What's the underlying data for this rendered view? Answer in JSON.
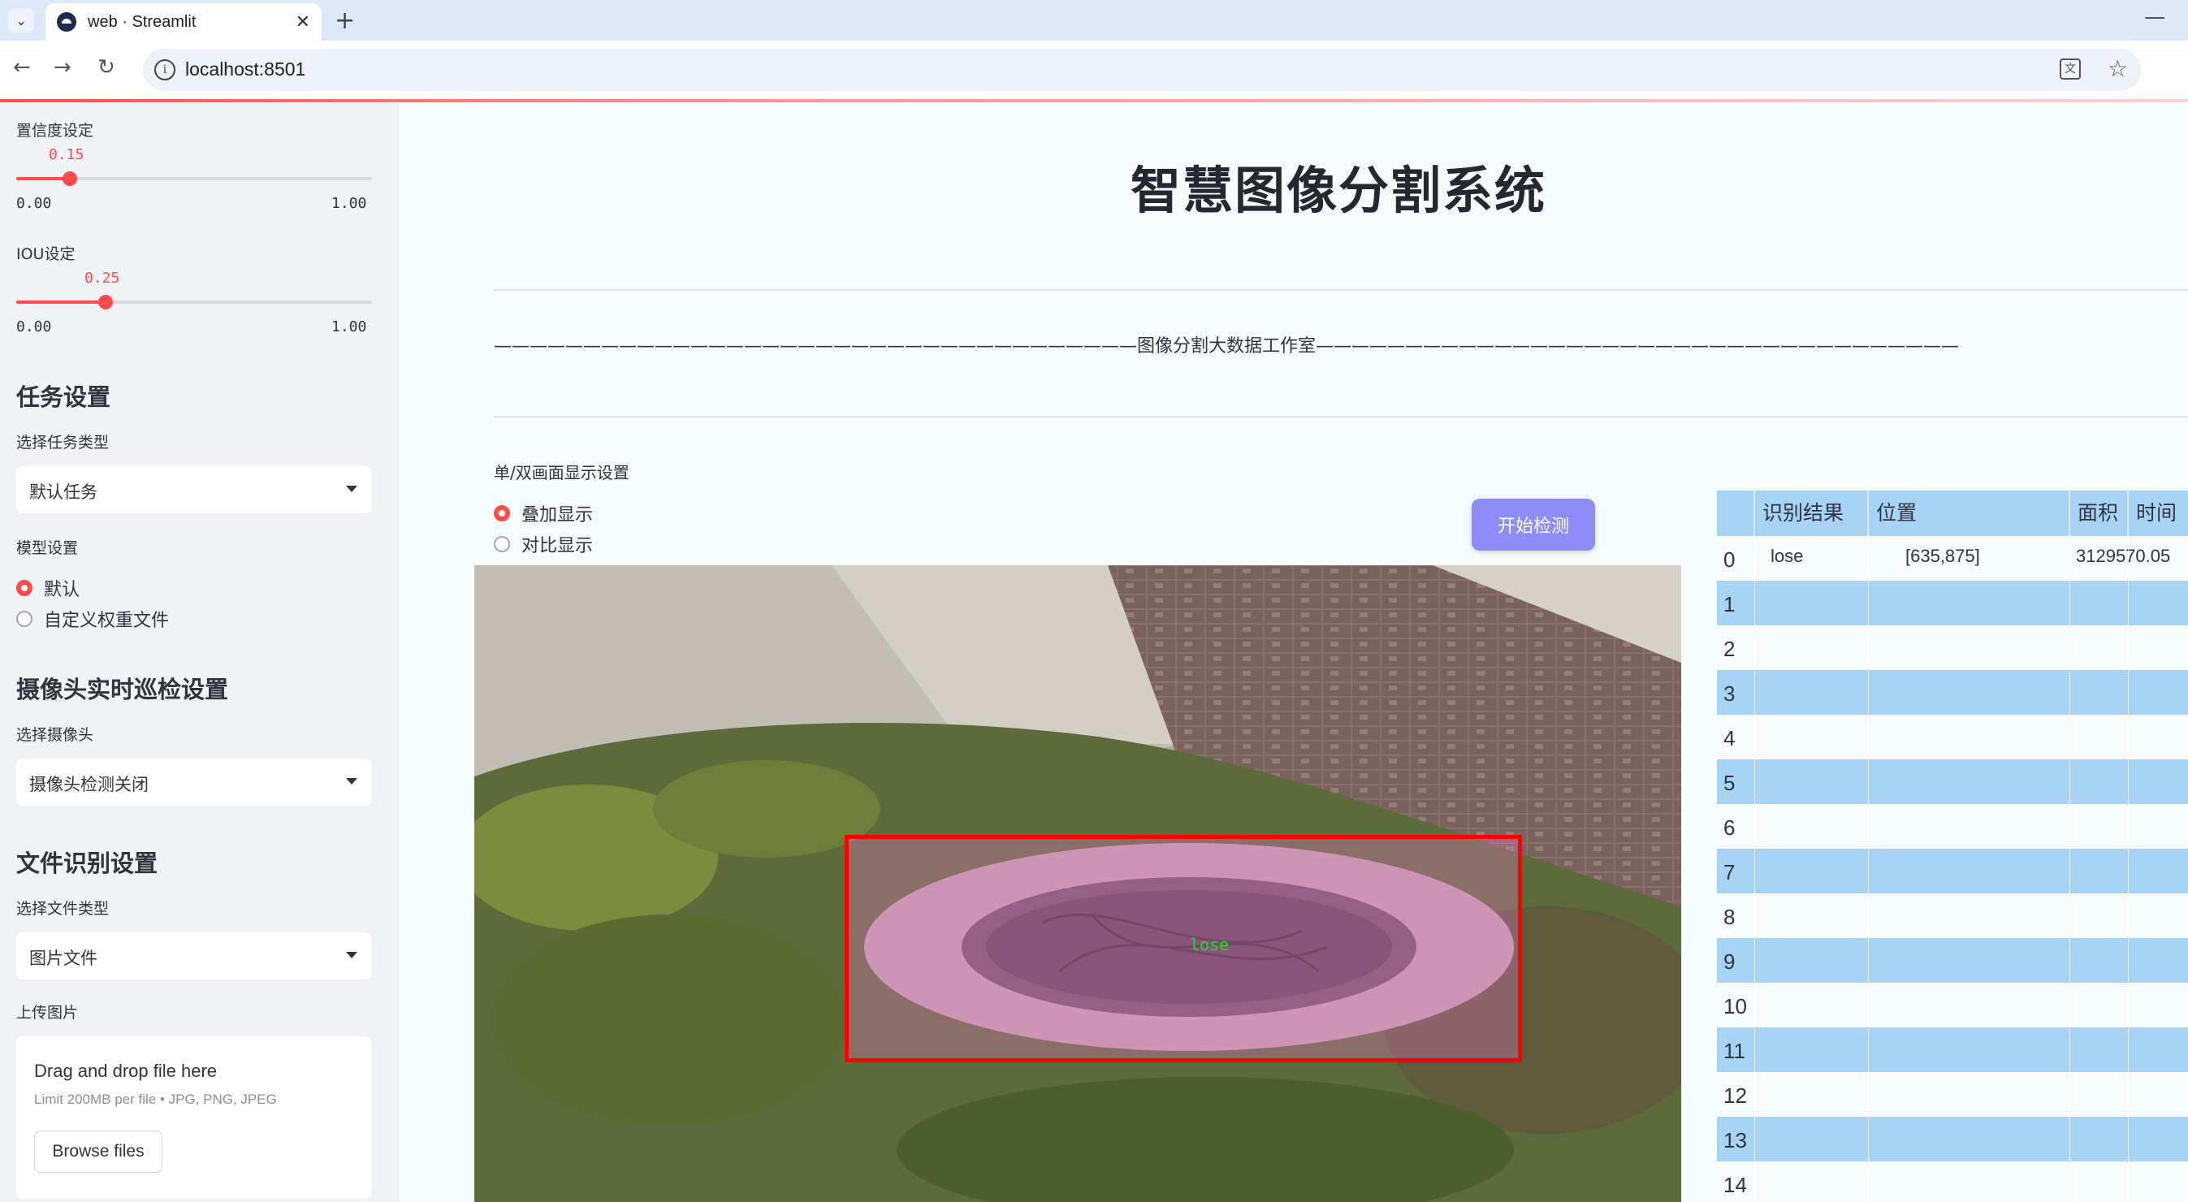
{
  "browser": {
    "tab_title": "web · Streamlit",
    "url": "localhost:8501"
  },
  "sidebar": {
    "confidence_label": "置信度设定",
    "confidence_value": "0.15",
    "confidence_min": "0.00",
    "confidence_max": "1.00",
    "confidence_level": 0.15,
    "iou_label": "IOU设定",
    "iou_value": "0.25",
    "iou_min": "0.00",
    "iou_max": "1.00",
    "iou_level": 0.25,
    "task_heading": "任务设置",
    "task_type_label": "选择任务类型",
    "task_type_value": "默认任务",
    "model_label": "模型设置",
    "model_options": [
      "默认",
      "自定义权重文件"
    ],
    "camera_heading": "摄像头实时巡检设置",
    "camera_select_label": "选择摄像头",
    "camera_select_value": "摄像头检测关闭",
    "file_heading": "文件识别设置",
    "file_type_label": "选择文件类型",
    "file_type_value": "图片文件",
    "upload_label": "上传图片",
    "upload_title": "Drag and drop file here",
    "upload_limit": "Limit 200MB per file • JPG, PNG, JPEG",
    "browse_label": "Browse files"
  },
  "main": {
    "title": "智慧图像分割系统",
    "banner": "————————————————————————————————————图像分割大数据工作室————————————————————————————————————",
    "display_label": "单/双画面显示设置",
    "display_options": [
      "叠加显示",
      "对比显示"
    ],
    "start_button": "开始检测",
    "detection_label": "lose"
  },
  "results_table": {
    "headers": [
      "识别结果",
      "位置",
      "面积",
      "时间"
    ],
    "rows": [
      {
        "index": "0",
        "result": "lose",
        "position": "[635,875]",
        "area": "3129570.05"
      },
      {
        "index": "1"
      },
      {
        "index": "2"
      },
      {
        "index": "3"
      },
      {
        "index": "4"
      },
      {
        "index": "5"
      },
      {
        "index": "6"
      },
      {
        "index": "7"
      },
      {
        "index": "8"
      },
      {
        "index": "9"
      },
      {
        "index": "10"
      },
      {
        "index": "11"
      },
      {
        "index": "12"
      },
      {
        "index": "13"
      },
      {
        "index": "14"
      }
    ]
  },
  "colors": {
    "accent": "#ff4b4b",
    "button": "#8e8cf7",
    "table_header": "#a7d4f5",
    "detection_box": "#ff0000"
  }
}
